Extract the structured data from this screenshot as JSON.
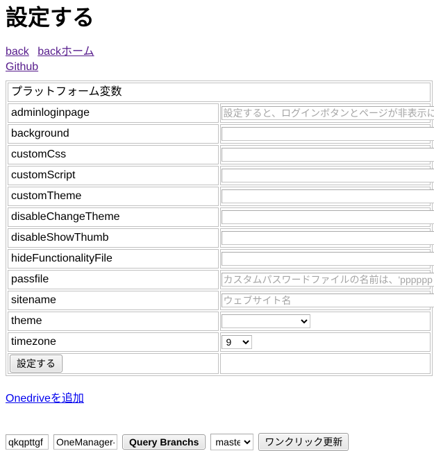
{
  "page": {
    "title": "設定する"
  },
  "nav_links": [
    {
      "label": "back",
      "name": "link-back"
    },
    {
      "label": "backホーム",
      "name": "link-back-home"
    },
    {
      "label": "Github",
      "name": "link-github"
    }
  ],
  "table": {
    "header": "プラットフォーム変数",
    "rows": [
      {
        "key": "adminloginpage",
        "type": "text",
        "value": "",
        "placeholder": "設定すると、ログインボタンとページが非表示になります。ログインを管理す"
      },
      {
        "key": "background",
        "type": "text",
        "value": "",
        "placeholder": ""
      },
      {
        "key": "customCss",
        "type": "text",
        "value": "",
        "placeholder": ""
      },
      {
        "key": "customScript",
        "type": "text",
        "value": "",
        "placeholder": ""
      },
      {
        "key": "customTheme",
        "type": "text",
        "value": "",
        "placeholder": ""
      },
      {
        "key": "disableChangeTheme",
        "type": "text",
        "value": "",
        "placeholder": ""
      },
      {
        "key": "disableShowThumb",
        "type": "text",
        "value": "",
        "placeholder": ""
      },
      {
        "key": "hideFunctionalityFile",
        "type": "text",
        "value": "",
        "placeholder": ""
      },
      {
        "key": "passfile",
        "type": "text",
        "value": "",
        "placeholder": "カスタムパスワードファイルの名前は、'pppppp '、'aaaa.txt 'などの場合があり"
      },
      {
        "key": "sitename",
        "type": "text",
        "value": "",
        "placeholder": "ウェブサイト名"
      },
      {
        "key": "theme",
        "type": "select",
        "value": "",
        "options": [
          ""
        ]
      },
      {
        "key": "timezone",
        "type": "select",
        "value": "9",
        "options": [
          "9"
        ]
      }
    ],
    "submit_label": "設定する"
  },
  "add_onedrive": {
    "label": "Onedriveを追加"
  },
  "update_bar": {
    "user_value": "qkqpttgf",
    "user_placeholder": "",
    "repo_value": "OneManager-php",
    "repo_placeholder": "",
    "query_button": "Query Branchs",
    "branch_value": "master",
    "branch_options": [
      "master"
    ],
    "update_button": "ワンクリック更新"
  },
  "colors": {
    "visited_link": "#551a8b",
    "link": "#0000ee",
    "border": "#c0c0c0",
    "placeholder": "#a5a5a5"
  }
}
